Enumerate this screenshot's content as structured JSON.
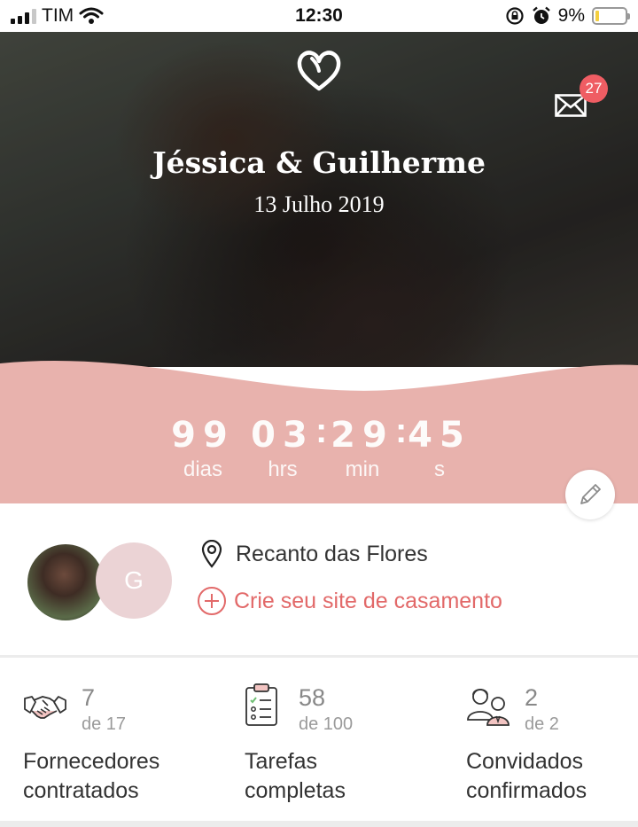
{
  "status_bar": {
    "carrier": "TIM",
    "time": "12:30",
    "battery_percent": "9%",
    "battery_level": 0.09,
    "icons": [
      "signal-icon",
      "wifi-icon",
      "rotation-lock-icon",
      "alarm-icon",
      "battery-icon"
    ]
  },
  "header": {
    "couple_names": "Jéssica & Guilherme",
    "wedding_date": "13 Julho 2019",
    "mail_badge_count": "27"
  },
  "countdown": {
    "days_value": "99",
    "days_label": "dias",
    "hours_value": "03",
    "hours_label": "hrs",
    "minutes_value": "29",
    "minutes_label": "min",
    "seconds_value": "45",
    "seconds_label": "s",
    "separator": ":"
  },
  "profile": {
    "second_avatar_initial": "G",
    "venue": "Recanto das Flores",
    "create_site_link": "Crie seu site de casamento"
  },
  "stats": [
    {
      "icon": "handshake-icon",
      "value": "7",
      "of": "de 17",
      "label_line1": "Fornecedores",
      "label_line2": "contratados"
    },
    {
      "icon": "checklist-icon",
      "value": "58",
      "of": "de 100",
      "label_line1": "Tarefas",
      "label_line2": "completas"
    },
    {
      "icon": "guests-icon",
      "value": "2",
      "of": "de 2",
      "label_line1": "Convidados",
      "label_line2": "confirmados"
    }
  ],
  "colors": {
    "accent_pink": "#e8b2ad",
    "link_red": "#e26969",
    "badge_red": "#ef5d63",
    "avatar_pink": "#ebd3d5"
  }
}
